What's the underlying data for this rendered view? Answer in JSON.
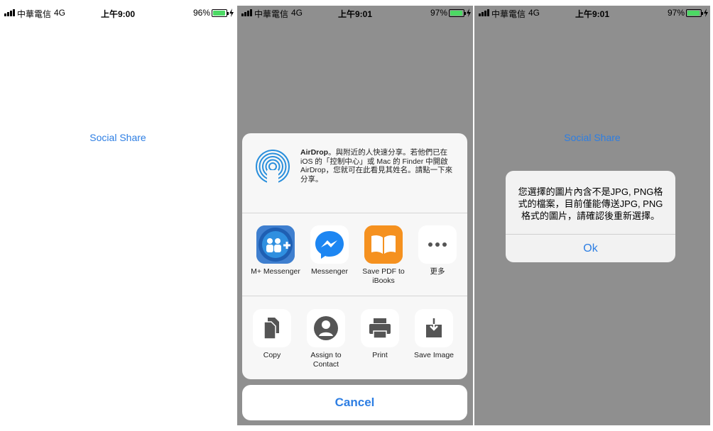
{
  "screens": [
    {
      "status": {
        "carrier": "中華電信",
        "network": "4G",
        "time": "上午9:00",
        "battery": "96%",
        "battery_level": 0.96
      },
      "social_share": "Social Share"
    },
    {
      "status": {
        "carrier": "中華電信",
        "network": "4G",
        "time": "上午9:01",
        "battery": "97%",
        "battery_level": 0.97
      },
      "airdrop": {
        "title": "AirDrop",
        "text": "。與附近的人快速分享。若他們已在iOS 的「控制中心」或 Mac 的 Finder 中開啟AirDrop，您就可在此看見其姓名。請點一下來分享。"
      },
      "apps": [
        {
          "label": "M+ Messenger",
          "icon": "m-plus-messenger-icon"
        },
        {
          "label": "Messenger",
          "icon": "messenger-icon"
        },
        {
          "label": "Save PDF to iBooks",
          "icon": "ibooks-icon"
        },
        {
          "label": "更多",
          "icon": "more-dots-icon"
        }
      ],
      "actions": [
        {
          "label": "Copy",
          "icon": "copy-icon"
        },
        {
          "label": "Assign to Contact",
          "icon": "contact-icon"
        },
        {
          "label": "Print",
          "icon": "print-icon"
        },
        {
          "label": "Save Image",
          "icon": "save-image-icon"
        }
      ],
      "cancel": "Cancel"
    },
    {
      "status": {
        "carrier": "中華電信",
        "network": "4G",
        "time": "上午9:01",
        "battery": "97%",
        "battery_level": 0.97
      },
      "social_share": "Social Share",
      "alert": {
        "message": "您選擇的圖片內含不是JPG, PNG格式的檔案，目前僅能傳送JPG, PNG格式的圖片，請確認後重新選擇。",
        "ok": "Ok"
      }
    }
  ],
  "colors": {
    "accent": "#2d7ee3",
    "battery_green": "#4cd964",
    "dim_overlay": "#8f8f8f"
  }
}
